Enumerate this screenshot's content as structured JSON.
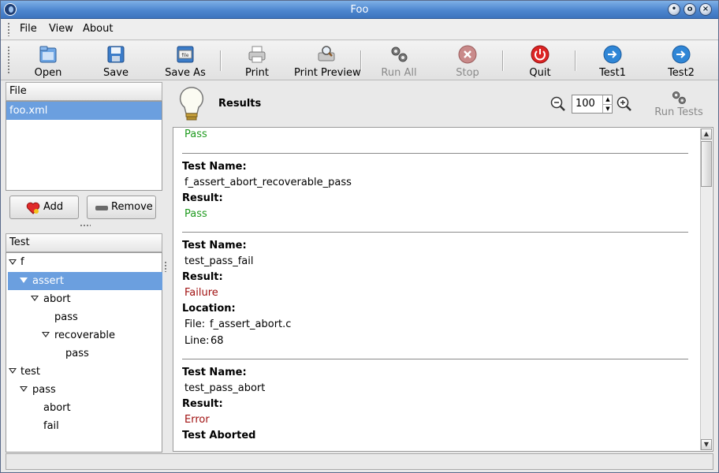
{
  "window": {
    "title": "Foo"
  },
  "menu": [
    "File",
    "View",
    "About"
  ],
  "toolbar": {
    "open": "Open",
    "save": "Save",
    "save_as": "Save As",
    "print": "Print",
    "print_preview": "Print Preview",
    "run_all": "Run All",
    "stop": "Stop",
    "quit": "Quit",
    "test1": "Test1",
    "test2": "Test2"
  },
  "file_panel": {
    "header": "File",
    "items": [
      "foo.xml"
    ]
  },
  "buttons": {
    "add": "Add",
    "remove": "Remove"
  },
  "test_panel": {
    "header": "Test",
    "tree": [
      "f",
      "assert",
      "abort",
      "pass",
      "recoverable",
      "pass",
      "test",
      "pass",
      "abort",
      "fail"
    ]
  },
  "results_bar": {
    "title": "Results",
    "zoom_value": "100",
    "run_tests": "Run Tests"
  },
  "results": {
    "top_result": "Pass",
    "entries": [
      {
        "test_name_label": "Test Name:",
        "test_name": "f_assert_abort_recoverable_pass",
        "result_label": "Result:",
        "result": "Pass"
      },
      {
        "test_name_label": "Test Name:",
        "test_name": "test_pass_fail",
        "result_label": "Result:",
        "result": "Failure",
        "location_label": "Location:",
        "file_label": "File:",
        "file": "f_assert_abort.c",
        "line_label": "Line:",
        "line": "68"
      },
      {
        "test_name_label": "Test Name:",
        "test_name": "test_pass_abort",
        "result_label": "Result:",
        "result": "Error",
        "note": "Test Aborted"
      }
    ]
  },
  "colors": {
    "pass": "#1e9a1e",
    "failure": "#a01010",
    "selection": "#6b9fdf",
    "titlebar": "#4d86cf"
  }
}
